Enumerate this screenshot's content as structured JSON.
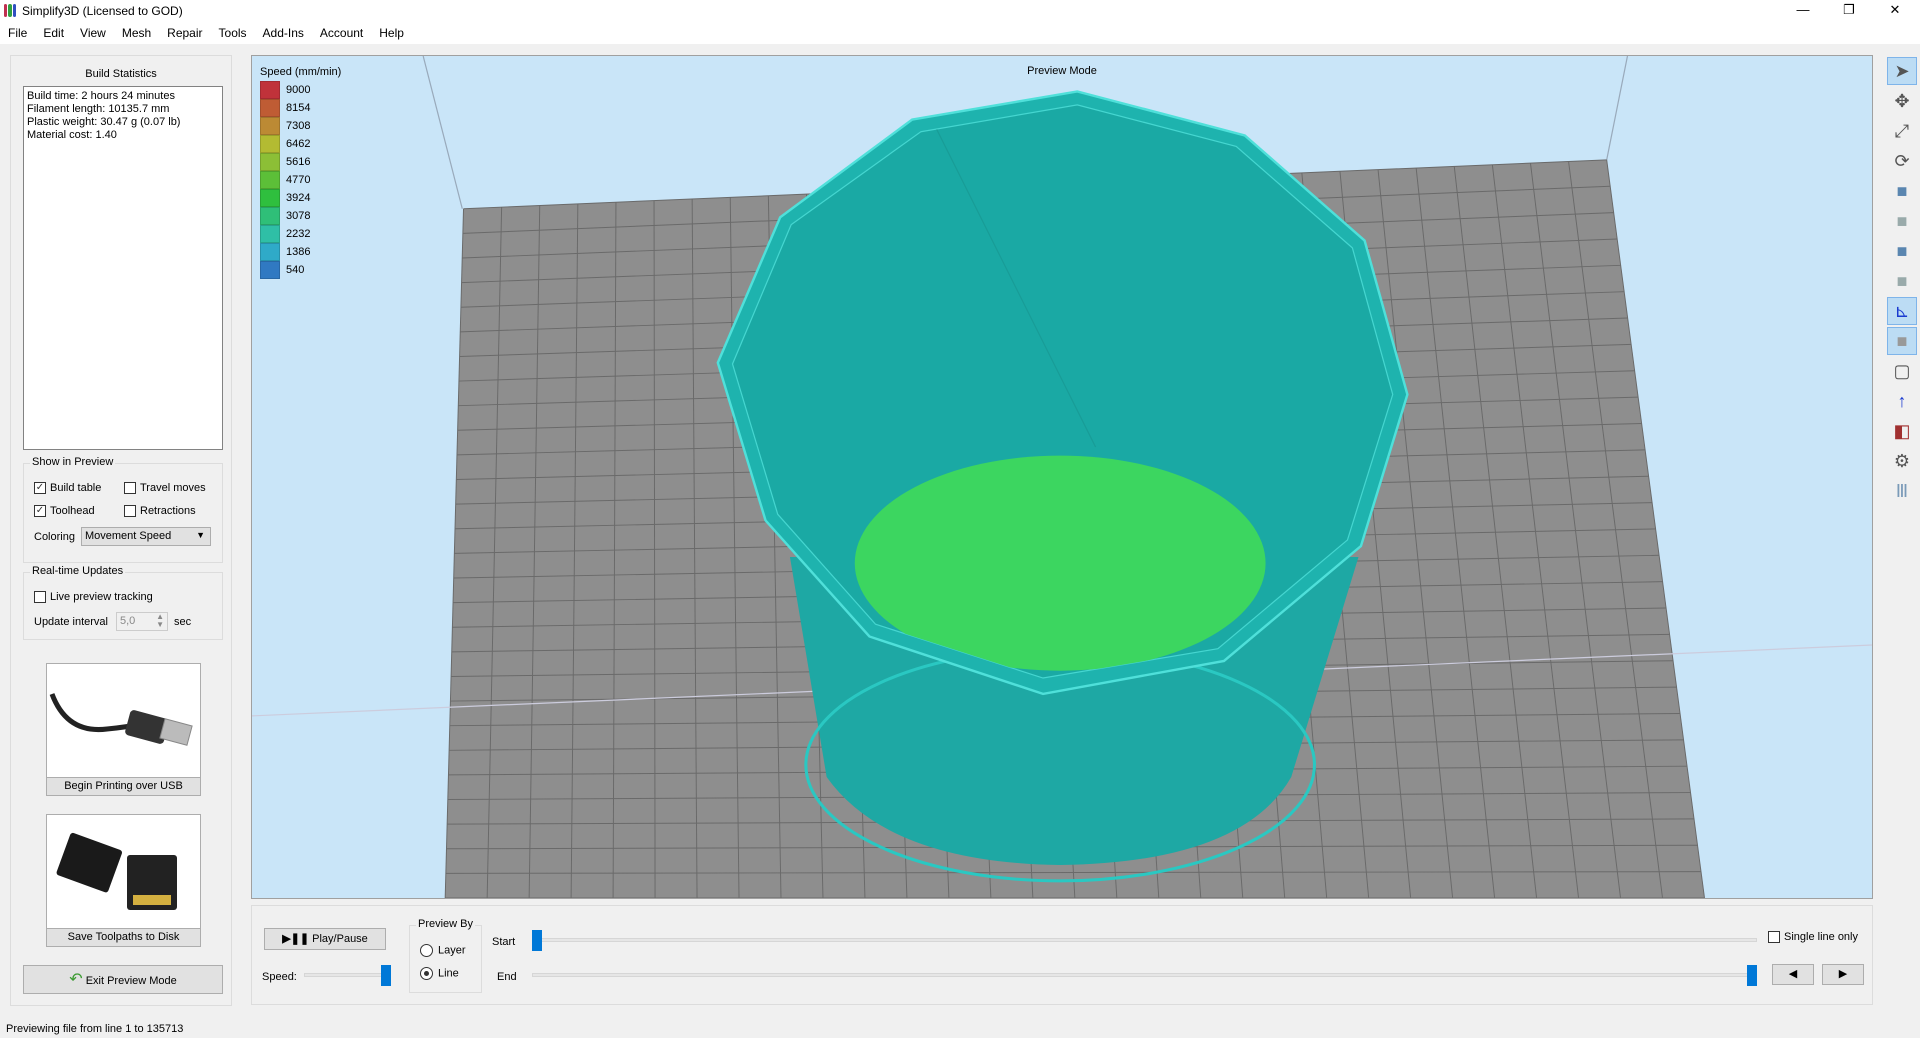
{
  "window": {
    "title": "Simplify3D (Licensed to GOD)",
    "minimize": "—",
    "maximize": "❐",
    "close": "✕"
  },
  "menu": [
    "File",
    "Edit",
    "View",
    "Mesh",
    "Repair",
    "Tools",
    "Add-Ins",
    "Account",
    "Help"
  ],
  "build_statistics": {
    "title": "Build Statistics",
    "lines": [
      "Build time: 2 hours 24 minutes",
      "Filament length: 10135.7 mm",
      "Plastic weight: 30.47 g (0.07 lb)",
      "Material cost: 1.40"
    ]
  },
  "show_in_preview": {
    "title": "Show in Preview",
    "build_table": {
      "label": "Build table",
      "checked": true
    },
    "travel_moves": {
      "label": "Travel moves",
      "checked": false
    },
    "toolhead": {
      "label": "Toolhead",
      "checked": true
    },
    "retractions": {
      "label": "Retractions",
      "checked": false
    },
    "coloring_label": "Coloring",
    "coloring_value": "Movement Speed"
  },
  "realtime": {
    "title": "Real-time Updates",
    "live_tracking": {
      "label": "Live preview tracking",
      "checked": false
    },
    "interval_label": "Update interval",
    "interval_value": "5,0",
    "interval_unit": "sec"
  },
  "buttons": {
    "usb": "Begin Printing over USB",
    "sd": "Save Toolpaths to Disk",
    "exit": "Exit Preview Mode"
  },
  "viewport": {
    "title": "Preview Mode",
    "legend_title": "Speed (mm/min)",
    "legend": [
      {
        "value": "9000",
        "color": "#c0323a"
      },
      {
        "value": "8154",
        "color": "#bf5c34"
      },
      {
        "value": "7308",
        "color": "#bc8a34"
      },
      {
        "value": "6462",
        "color": "#b3bb32"
      },
      {
        "value": "5616",
        "color": "#8cbf36"
      },
      {
        "value": "4770",
        "color": "#5cbf38"
      },
      {
        "value": "3924",
        "color": "#2fbf3e"
      },
      {
        "value": "3078",
        "color": "#2fbf78"
      },
      {
        "value": "2232",
        "color": "#2fbfa6"
      },
      {
        "value": "1386",
        "color": "#2faac8"
      },
      {
        "value": "540",
        "color": "#3079c2"
      }
    ],
    "model_color": "#1fb3ad",
    "floor_color": "#3cd660"
  },
  "toolbar": [
    "select-icon",
    "move-icon",
    "scale-icon",
    "rotate-icon",
    "view-top-icon",
    "view-front-icon",
    "view-left-icon",
    "view-right-icon",
    "axes-icon",
    "solid-view-icon",
    "wireframe-icon",
    "normals-icon",
    "section-icon",
    "settings-icon",
    "machine-icon"
  ],
  "playback": {
    "play_pause": "Play/Pause",
    "speed_label": "Speed:",
    "speed": 1.0,
    "preview_by_title": "Preview By",
    "layer_label": "Layer",
    "line_label": "Line",
    "selected": "Line",
    "start_label": "Start",
    "end_label": "End",
    "start": 0.0,
    "end": 1.0,
    "single_line_label": "Single line only",
    "single_line_checked": false,
    "prev": "◀",
    "next": "▶"
  },
  "status": "Previewing file from line 1 to 135713"
}
